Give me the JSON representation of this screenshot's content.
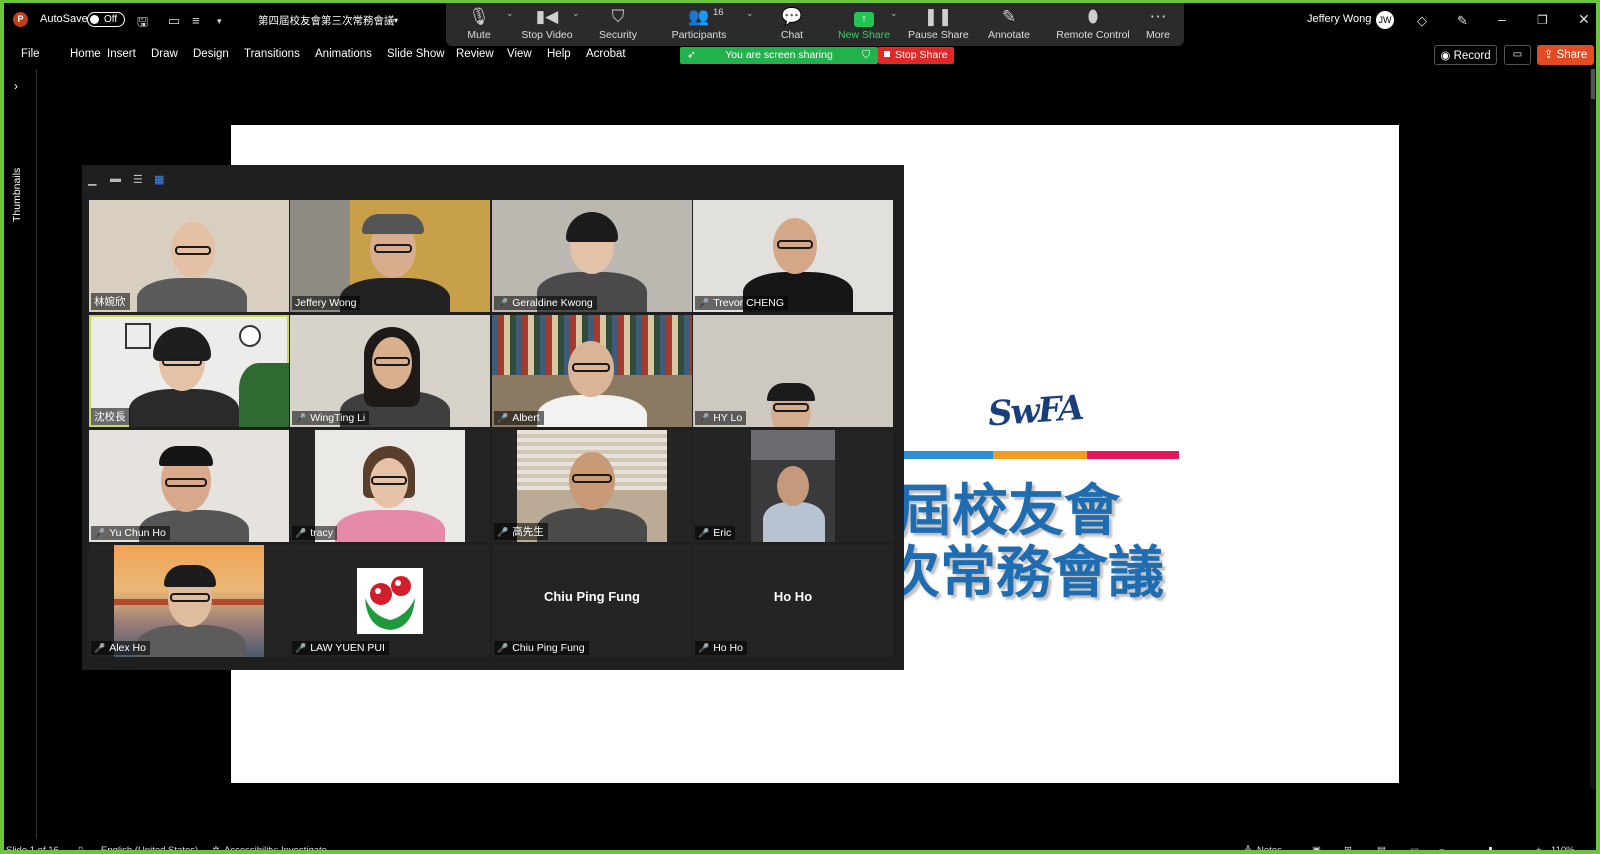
{
  "window": {
    "autosave_label": "AutoSave",
    "autosave_state": "Off",
    "file_title": "第四屆校友會第三次常務會議",
    "user_name": "Jeffery Wong"
  },
  "zoom_toolbar": {
    "participants_count": "16",
    "buttons": [
      {
        "label": "Mute",
        "icon": "microphone-icon"
      },
      {
        "label": "Stop Video",
        "icon": "video-camera-icon"
      },
      {
        "label": "Security",
        "icon": "shield-icon"
      },
      {
        "label": "Participants",
        "icon": "people-icon"
      },
      {
        "label": "Chat",
        "icon": "chat-bubble-icon"
      },
      {
        "label": "New Share",
        "icon": "share-up-arrow-icon"
      },
      {
        "label": "Pause Share",
        "icon": "pause-icon"
      },
      {
        "label": "Annotate",
        "icon": "pen-icon"
      },
      {
        "label": "Remote Control",
        "icon": "mouse-icon"
      },
      {
        "label": "More",
        "icon": "more-dots-icon"
      }
    ],
    "sharing_banner": "You are screen sharing",
    "stop_share_label": "Stop Share"
  },
  "ribbon": {
    "tabs": [
      "File",
      "Home",
      "Insert",
      "Draw",
      "Design",
      "Transitions",
      "Animations",
      "Slide Show",
      "Review",
      "View",
      "Help",
      "Acrobat"
    ],
    "record_label": "Record",
    "share_label": "Share"
  },
  "sidebar": {
    "label": "Thumbnails"
  },
  "slide": {
    "title_line1": "屆校友會",
    "title_line2": "次常務會議",
    "accent_colors": [
      "#2d8fd5",
      "#f39c1f",
      "#e8175d"
    ]
  },
  "gallery": {
    "tiles": [
      {
        "name": "林婉欣",
        "muted": false
      },
      {
        "name": "Jeffery Wong",
        "muted": false
      },
      {
        "name": "Geraldine Kwong",
        "muted": true
      },
      {
        "name": "Trevor CHENG",
        "muted": true
      },
      {
        "name": "沈校長",
        "muted": false
      },
      {
        "name": "WingTing Li",
        "muted": true
      },
      {
        "name": "Albert",
        "muted": true
      },
      {
        "name": "HY Lo",
        "muted": true
      },
      {
        "name": "Yu Chun Ho",
        "muted": true
      },
      {
        "name": "tracy",
        "muted": true
      },
      {
        "name": "高先生",
        "muted": true
      },
      {
        "name": "Eric",
        "muted": true
      },
      {
        "name": "Alex Ho",
        "muted": true
      },
      {
        "name": "LAW YUEN PUI",
        "muted": true
      },
      {
        "name": "Chiu Ping Fung",
        "muted": true
      },
      {
        "name": "Ho Ho",
        "muted": true
      }
    ]
  },
  "status": {
    "slide_info": "Slide 1 of 16",
    "language": "English (United States)",
    "accessibility": "Accessibility: Investigate",
    "notes_label": "Notes",
    "zoom_level": "110%"
  }
}
